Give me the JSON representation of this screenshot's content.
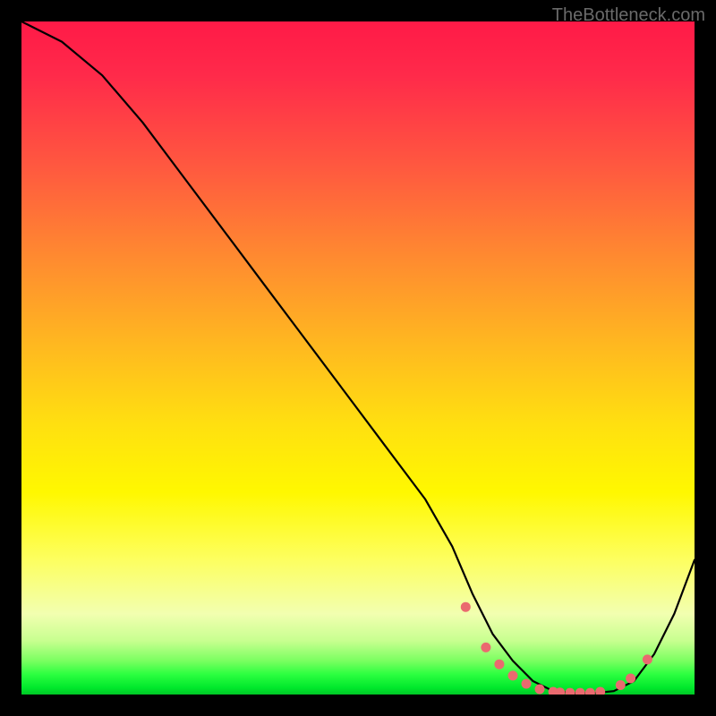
{
  "watermark": "TheBottleneck.com",
  "chart_data": {
    "type": "line",
    "title": "",
    "xlabel": "",
    "ylabel": "",
    "xlim": [
      0,
      100
    ],
    "ylim": [
      0,
      100
    ],
    "series": [
      {
        "name": "curve",
        "x": [
          0,
          6,
          12,
          18,
          24,
          30,
          36,
          42,
          48,
          54,
          60,
          64,
          67,
          70,
          73,
          76,
          79,
          82,
          85,
          88,
          91,
          94,
          97,
          100
        ],
        "values": [
          100,
          97,
          92,
          85,
          77,
          69,
          61,
          53,
          45,
          37,
          29,
          22,
          15,
          9,
          5,
          2,
          0.5,
          0.2,
          0.2,
          0.5,
          2,
          6,
          12,
          20
        ]
      }
    ],
    "markers": {
      "name": "dots",
      "x": [
        66,
        69,
        71,
        73,
        75,
        77,
        79,
        80,
        81.5,
        83,
        84.5,
        86,
        89,
        90.5,
        93
      ],
      "values": [
        13,
        7,
        4.5,
        2.8,
        1.6,
        0.8,
        0.4,
        0.3,
        0.25,
        0.25,
        0.25,
        0.4,
        1.4,
        2.4,
        5.2
      ]
    },
    "gradient_stops": [
      {
        "pos": 0,
        "color": "#ff1a47"
      },
      {
        "pos": 22,
        "color": "#ff5a3f"
      },
      {
        "pos": 48,
        "color": "#ffb820"
      },
      {
        "pos": 70,
        "color": "#fff800"
      },
      {
        "pos": 92,
        "color": "#c8ff90"
      },
      {
        "pos": 100,
        "color": "#00c826"
      }
    ]
  }
}
